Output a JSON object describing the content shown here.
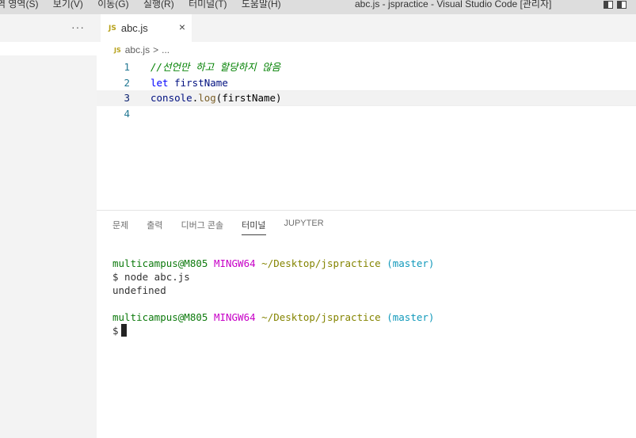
{
  "titlebar": {
    "menus": [
      "역 영역(S)",
      "보기(V)",
      "이동(G)",
      "실행(R)",
      "터미널(T)",
      "도움말(H)"
    ],
    "window_title": "abc.js - jspractice - Visual Studio Code [관리자]"
  },
  "sidebar": {
    "more_label": "···"
  },
  "editor": {
    "tab": {
      "badge": "JS",
      "label": "abc.js",
      "close": "×"
    },
    "breadcrumb": {
      "badge": "JS",
      "file": "abc.js",
      "separator": ">",
      "rest": "..."
    },
    "lines": [
      {
        "num": "1",
        "text": "//선언만 하고 할당하지 않음"
      },
      {
        "num": "2",
        "kw": "let",
        "ident": "firstName"
      },
      {
        "num": "3",
        "obj": "console",
        "dot": ".",
        "method": "log",
        "args": "(firstName)"
      },
      {
        "num": "4",
        "text": ""
      }
    ]
  },
  "panel": {
    "tabs": [
      "문제",
      "출력",
      "디버그 콘솔",
      "터미널",
      "JUPYTER"
    ],
    "active_tab": "터미널"
  },
  "terminal": {
    "prompt1": {
      "user": "multicampus@M805",
      "host": "MINGW64",
      "path": "~/Desktop/jspractice",
      "branch": "(master)"
    },
    "command": "$ node abc.js",
    "output": "undefined",
    "prompt2": {
      "user": "multicampus@M805",
      "host": "MINGW64",
      "path": "~/Desktop/jspractice",
      "branch": "(master)"
    },
    "input_prompt": "$"
  }
}
